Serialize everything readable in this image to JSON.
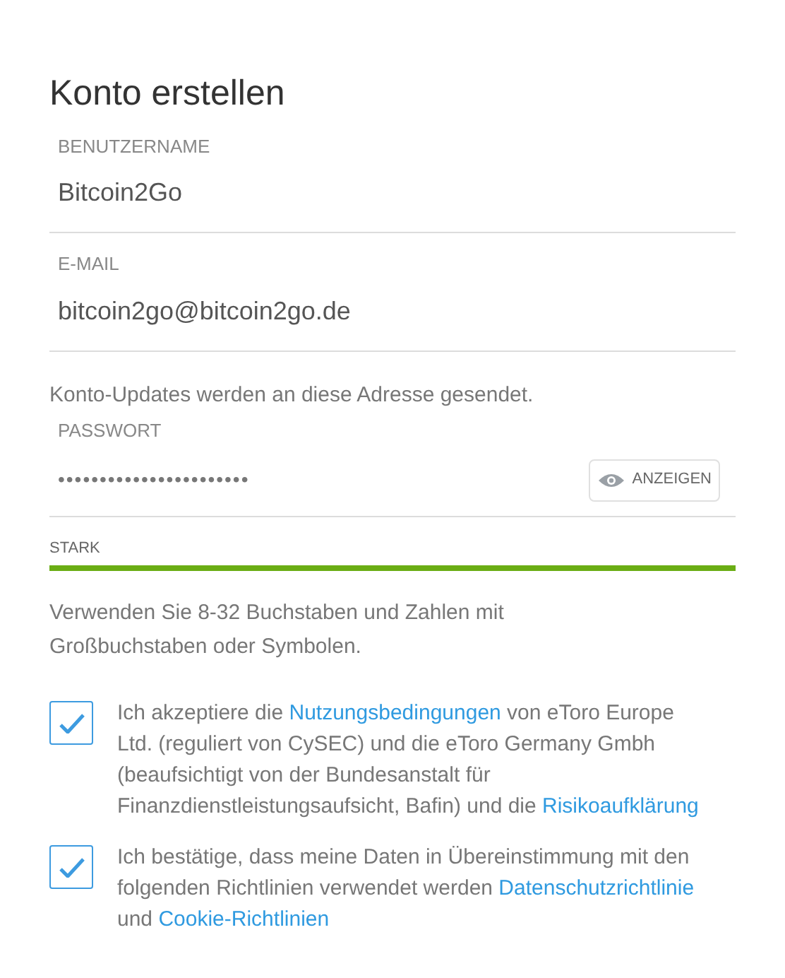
{
  "title": "Konto erstellen",
  "fields": [
    {
      "label": "BENUTZERNAME",
      "value": "Bitcoin2Go",
      "kind": "text"
    },
    {
      "label": "E-MAIL",
      "value": "bitcoin2go@bitcoin2go.de",
      "kind": "text",
      "hint": "Konto-Updates werden an diese Adresse gesendet."
    },
    {
      "label": "PASSWORT",
      "value": "•••••••••••••••••••••••",
      "kind": "password",
      "reveal_button": "ANZEIGEN"
    }
  ],
  "strength": {
    "label": "STARK",
    "level": 1,
    "color": "#6aad14"
  },
  "password_rule": "Verwenden Sie 8-32 Buchstaben und Zahlen mit Großbuchstaben oder Symbolen.",
  "consents": [
    {
      "checked": true,
      "segments": [
        {
          "kind": "text",
          "text": "Ich akzeptiere die "
        },
        {
          "kind": "link",
          "text": "Nutzungsbedingungen"
        },
        {
          "kind": "text",
          "text": " von eToro Europe Ltd. (reguliert von CySEC) und die eToro Germany Gmbh (beaufsichtigt von der Bundesanstalt für Finanzdienstleistungsaufsicht, Bafin) und die "
        },
        {
          "kind": "link",
          "text": "Risikoaufklärung"
        }
      ]
    },
    {
      "checked": true,
      "segments": [
        {
          "kind": "text",
          "text": "Ich bestätige, dass meine Daten in Übereinstimmung mit den folgenden Richtlinien verwendet werden "
        },
        {
          "kind": "link",
          "text": "Datenschutzrichtlinie"
        },
        {
          "kind": "text",
          "text": " und "
        },
        {
          "kind": "link",
          "text": "Cookie-Richtlinien"
        }
      ]
    }
  ]
}
